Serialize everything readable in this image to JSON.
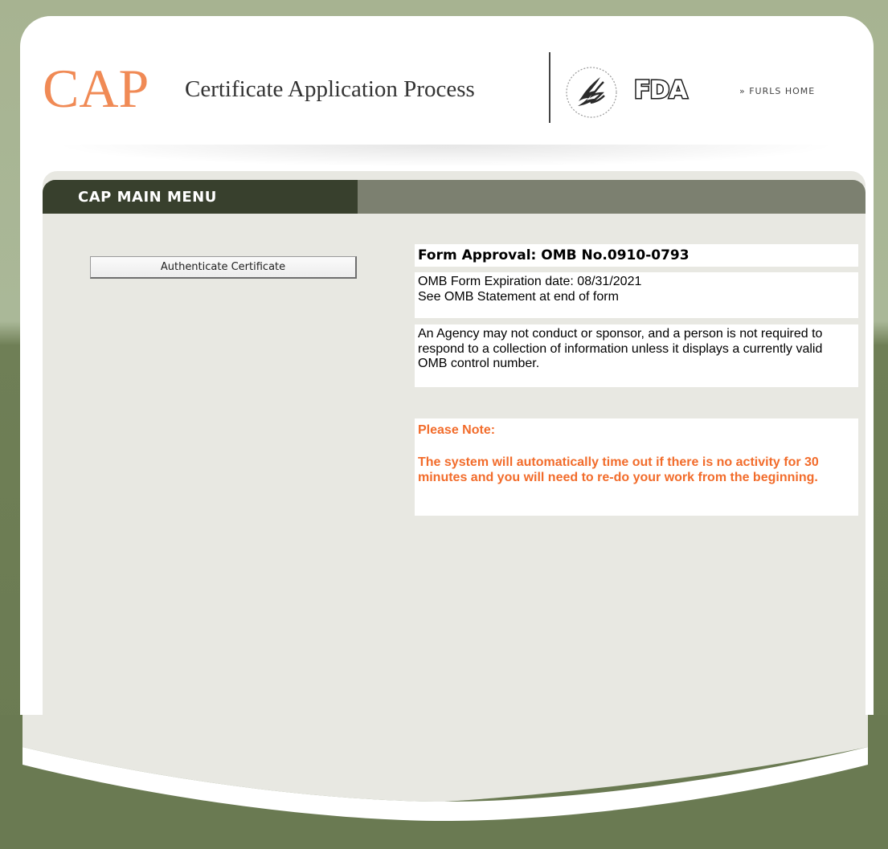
{
  "header": {
    "logo_text": "CAP",
    "subtitle": "Certificate Application Process",
    "hhs_logo_icon": "hhs-eagle-icon",
    "fda_logo_text": "FDA",
    "furls_home_link": "» FURLS HOME"
  },
  "menu": {
    "title": "CAP MAIN MENU",
    "authenticate_button": "Authenticate Certificate"
  },
  "omb": {
    "approval_title": "Form Approval: OMB No.0910-0793",
    "expiration_line": "OMB Form Expiration date: 08/31/2021",
    "statement_line": "See OMB Statement at end of form",
    "agency_notice": "An Agency may not conduct or sponsor, and a person is not required to respond to a collection of information unless it displays a currently valid OMB control number."
  },
  "note": {
    "heading": "Please Note:",
    "message": "The system will automatically time out if there is no activity for 30 minutes and you will need to re-do your work from the beginning."
  },
  "colors": {
    "cap_orange": "#f08a55",
    "menu_dark": "#38402d",
    "menu_bar": "#7c8070",
    "panel_bg": "#e8e8e2",
    "note_orange": "#f26c2b",
    "page_green": "#6a7a52"
  }
}
